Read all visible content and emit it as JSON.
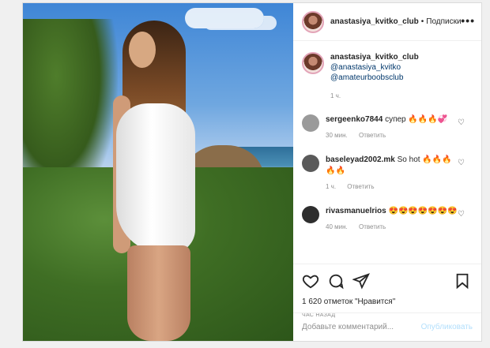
{
  "header": {
    "username": "anastasiya_kvitko_club",
    "separator": "•",
    "follow_label": "Подписки",
    "more_icon": "more-horizontal-icon"
  },
  "caption": {
    "username": "anastasiya_kvitko_club",
    "mention1": "@anastasiya_kvitko",
    "mention2": "@amateurboobsclub",
    "time": "1 ч."
  },
  "comments": [
    {
      "username": "sergeenko7844",
      "text": "супер 🔥🔥🔥💞",
      "time": "30 мин.",
      "reply": "Ответить",
      "avatar_color": "#9a9a9a"
    },
    {
      "username": "baseleyad2002.mk",
      "text": "So hot 🔥🔥🔥🔥🔥",
      "time": "1 ч.",
      "reply": "Ответить",
      "avatar_color": "#5a5a5a"
    },
    {
      "username": "rivasmanuelrios",
      "text": "😍😍😍😍😍😍😍",
      "time": "40 мин.",
      "reply": "Ответить",
      "avatar_color": "#2e2e2e"
    }
  ],
  "actions": {
    "likes": "1 620 отметок \"Нравится\"",
    "ago": "ЧАС НАЗАД"
  },
  "add_comment": {
    "placeholder": "Добавьте комментарий...",
    "publish": "Опубликовать"
  }
}
